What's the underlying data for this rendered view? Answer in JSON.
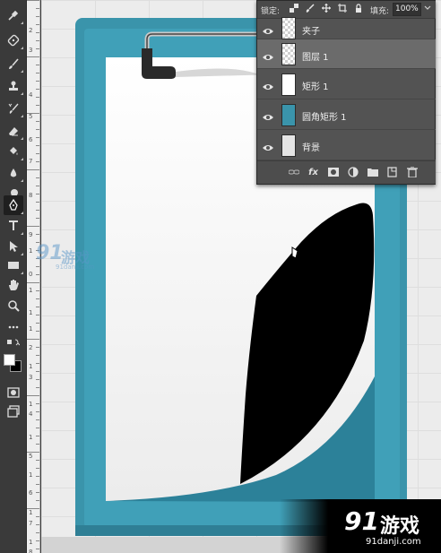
{
  "layers_panel": {
    "lock_label": "锁定:",
    "fill_label": "填充:",
    "fill_value": "100%",
    "layers": [
      {
        "name": "夹子",
        "thumb": "checker",
        "selected": false
      },
      {
        "name": "图层 1",
        "thumb": "checker",
        "selected": true
      },
      {
        "name": "矩形 1",
        "thumb": "white",
        "selected": false
      },
      {
        "name": "圆角矩形 1",
        "thumb": "teal",
        "selected": false
      },
      {
        "name": "背景",
        "thumb": "light",
        "selected": false
      }
    ],
    "footer_icons": [
      "link-icon",
      "fx-icon",
      "mask-icon",
      "adjustment-icon",
      "folder-icon",
      "new-layer-icon",
      "trash-icon"
    ],
    "fx_label": "fx"
  },
  "watermark": {
    "logo": "91",
    "name": "游戏",
    "url": "91danji.com"
  },
  "ruler_numbers": [
    "2",
    "3",
    "4",
    "5",
    "6",
    "7",
    "8",
    "9",
    "1",
    "0",
    "1",
    "1",
    "1",
    "2",
    "1",
    "3",
    "1",
    "4",
    "1",
    "5",
    "1",
    "6",
    "1",
    "7",
    "1",
    "8"
  ],
  "colors": {
    "teal_frame": "#3a94ab",
    "teal_dark": "#1f6d82",
    "paper": "#ffffff",
    "shape": "#000000",
    "clip": "#2a2a2a",
    "accent": "#f5a623"
  },
  "tools": [
    "eyedropper-icon",
    "healing-icon",
    "brush-icon",
    "stamp-icon",
    "history-brush-icon",
    "eraser-icon",
    "bucket-icon",
    "blur-icon",
    "dodge-icon",
    "pen-icon",
    "type-icon",
    "path-select-icon",
    "rectangle-icon",
    "hand-icon",
    "zoom-icon",
    "more-icon",
    "quickmask-icon",
    "screenmode-icon"
  ]
}
